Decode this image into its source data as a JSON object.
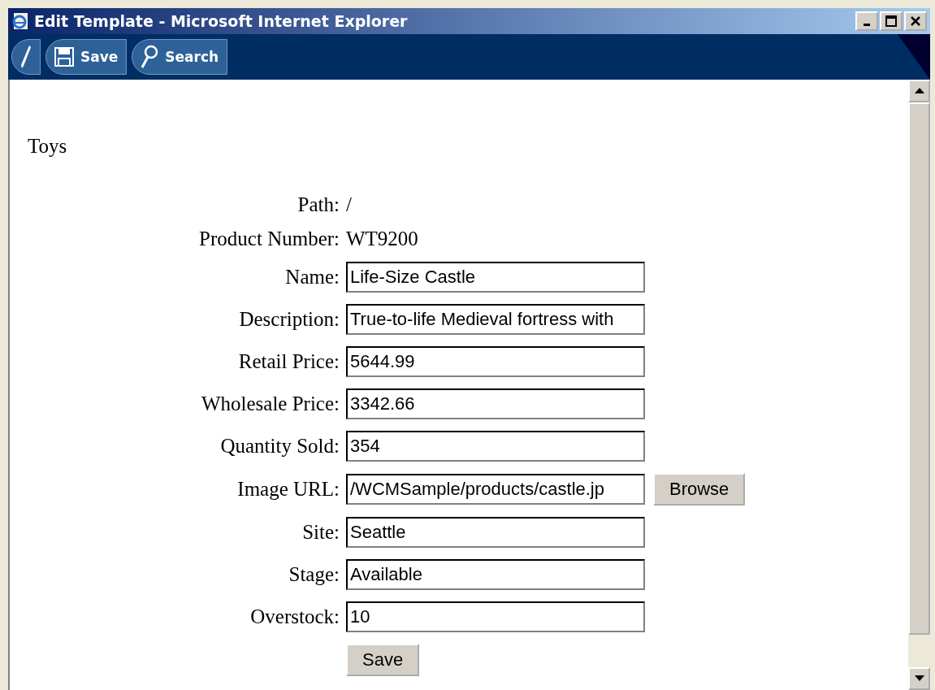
{
  "window": {
    "title": "Edit Template - Microsoft Internet Explorer"
  },
  "toolbar": [
    {
      "kind": "edit"
    },
    {
      "kind": "save",
      "label": "Save"
    },
    {
      "kind": "search",
      "label": "Search"
    }
  ],
  "heading": "Toys",
  "fields": [
    {
      "kind": "text",
      "label": "Path:",
      "value": "/"
    },
    {
      "kind": "text",
      "label": "Product Number:",
      "value": "WT9200"
    },
    {
      "kind": "input",
      "label": "Name:",
      "value": "Life-Size Castle"
    },
    {
      "kind": "input",
      "label": "Description:",
      "value": "True-to-life Medieval fortress with"
    },
    {
      "kind": "input",
      "label": "Retail Price:",
      "value": "5644.99"
    },
    {
      "kind": "input",
      "label": "Wholesale Price:",
      "value": "3342.66"
    },
    {
      "kind": "input",
      "label": "Quantity Sold:",
      "value": "354"
    },
    {
      "kind": "file",
      "label": "Image URL:",
      "value": "/WCMSample/products/castle.jp",
      "button": "Browse"
    },
    {
      "kind": "input",
      "label": "Site:",
      "value": "Seattle"
    },
    {
      "kind": "input",
      "label": "Stage:",
      "value": "Available"
    },
    {
      "kind": "input",
      "label": "Overstock:",
      "value": "10"
    }
  ],
  "submit": "Save"
}
